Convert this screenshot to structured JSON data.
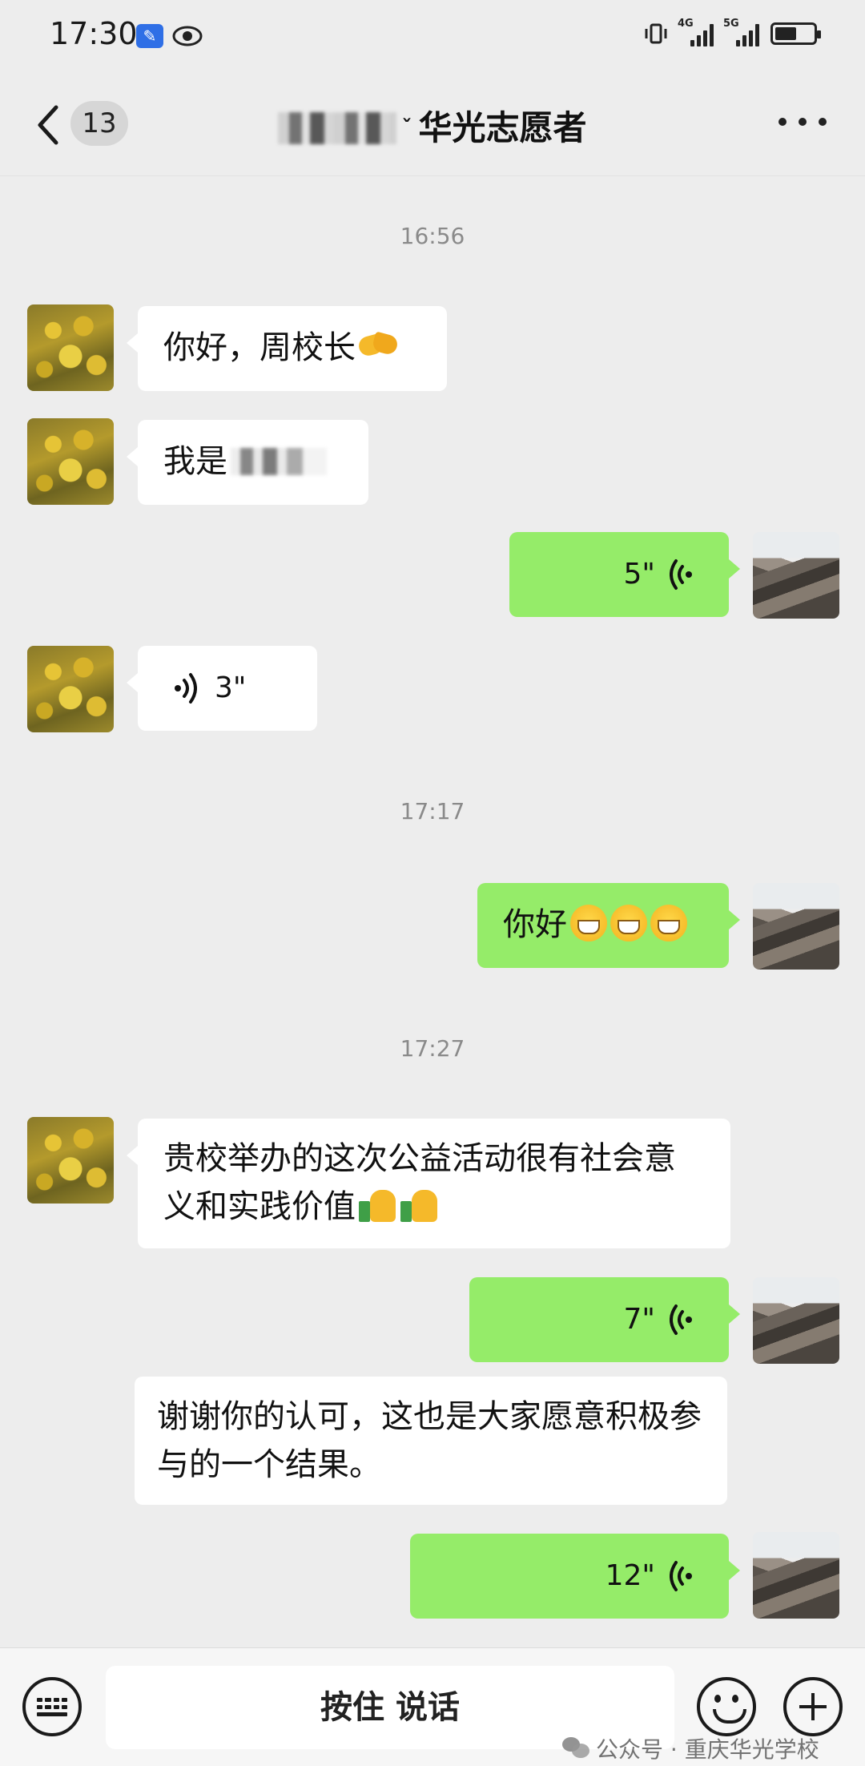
{
  "status_bar": {
    "time": "17:30",
    "network_1": "4G",
    "network_2": "5G",
    "battery_level": 0.62
  },
  "header": {
    "unread_count": "13",
    "title": "华光志愿者"
  },
  "timestamps": [
    "16:56",
    "17:17",
    "17:27"
  ],
  "messages": [
    {
      "side": "left",
      "text": "你好，周校长",
      "emoji": "handshake"
    },
    {
      "side": "left",
      "text": "我是"
    },
    {
      "side": "right",
      "voice_duration": "5\""
    },
    {
      "side": "left",
      "voice_duration": "3\""
    },
    {
      "side": "right",
      "text": "你好",
      "emoji": "grin x3"
    },
    {
      "side": "left",
      "text": "贵校举办的这次公益活动很有社会意义和实践价值",
      "emoji": "thumbs-up x2"
    },
    {
      "side": "right",
      "voice_duration": "7\""
    },
    {
      "side": "left",
      "text": "谢谢你的认可，这也是大家愿意积极参与的一个结果。"
    },
    {
      "side": "right",
      "voice_duration": "12\""
    }
  ],
  "input_bar": {
    "hold_to_talk": "按住 说话"
  },
  "watermark": {
    "text": "公众号 · 重庆华光学校"
  },
  "colors": {
    "background": "#ededed",
    "outgoing_bubble": "#95ec69",
    "incoming_bubble": "#ffffff"
  }
}
